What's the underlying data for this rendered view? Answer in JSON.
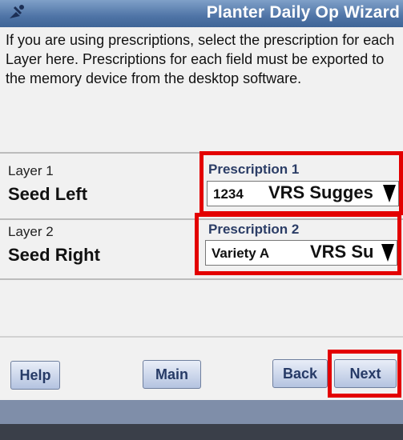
{
  "window": {
    "title": "Planter Daily Op Wizard"
  },
  "instructions": "If you are using prescriptions, select the prescription for each Layer here. Prescriptions for each field must be exported to the memory device from the desktop software.",
  "layers": [
    {
      "label": "Layer 1",
      "name": "Seed Left",
      "prescription_label": "Prescription 1",
      "selected_value": "1234",
      "selected_value_suffix": "VRS Sugges"
    },
    {
      "label": "Layer 2",
      "name": "Seed Right",
      "prescription_label": "Prescription 2",
      "selected_value": "Variety A",
      "selected_value_suffix": "VRS Su"
    }
  ],
  "buttons": {
    "help": "Help",
    "main": "Main",
    "back": "Back",
    "next": "Next"
  },
  "colors": {
    "highlight": "#e30000",
    "titlebar": "#4f74a6"
  }
}
